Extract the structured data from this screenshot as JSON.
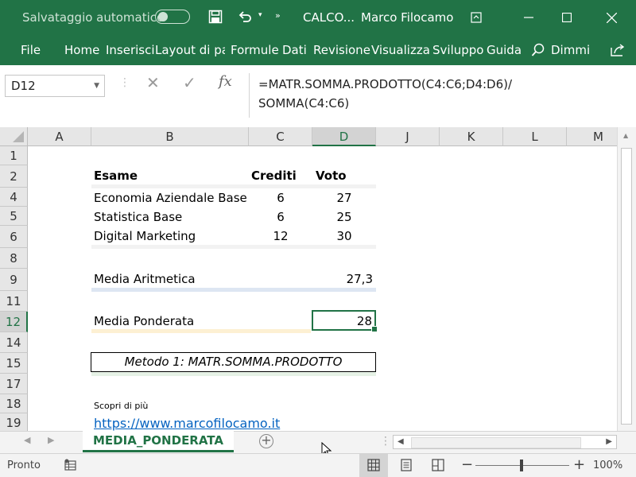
{
  "titlebar": {
    "autosave_label": "Salvataggio automatico",
    "doc_title": "CALCO...",
    "user": "Marco Filocamo"
  },
  "ribbon": {
    "tabs": [
      "File",
      "Home",
      "Inserisci",
      "Layout di pa",
      "Formule",
      "Dati",
      "Revisione",
      "Visualizza",
      "Sviluppo",
      "Guida"
    ],
    "tell_me": "Dimmi"
  },
  "formula_bar": {
    "name_box": "D12",
    "fx": "fx",
    "formula_line1": "=MATR.SOMMA.PRODOTTO(C4:C6;D4:D6)/",
    "formula_line2": "SOMMA(C4:C6)"
  },
  "grid": {
    "columns": [
      "A",
      "B",
      "C",
      "D",
      "J",
      "K",
      "L",
      "M"
    ],
    "rows": [
      "1",
      "2",
      "4",
      "5",
      "6",
      "8",
      "9",
      "11",
      "12",
      "14",
      "15",
      "17",
      "18",
      "19"
    ],
    "header": {
      "esame": "Esame",
      "crediti": "Crediti",
      "voto": "Voto"
    },
    "exams": [
      {
        "name": "Economia Aziendale Base",
        "crediti": "6",
        "voto": "27"
      },
      {
        "name": "Statistica Base",
        "crediti": "6",
        "voto": "25"
      },
      {
        "name": "Digital Marketing",
        "crediti": "12",
        "voto": "30"
      }
    ],
    "media_aritmetica_label": "Media Aritmetica",
    "media_aritmetica_value": "27,3",
    "media_ponderata_label": "Media Ponderata",
    "media_ponderata_value": "28",
    "metodo": "Metodo 1: MATR.SOMMA.PRODOTTO",
    "scopri": "Scopri di più",
    "link": "https://www.marcofilocamo.it"
  },
  "sheets": {
    "active": "MEDIA_PONDERATA"
  },
  "statusbar": {
    "status": "Pronto",
    "zoom": "100%"
  },
  "colors": {
    "excel_green": "#217346",
    "band_gray": "#f2f2f2",
    "band_blue": "#dde6f2",
    "band_yellow": "#fdf0d3",
    "band_green": "#e6f2e6",
    "link": "#0563c1"
  }
}
